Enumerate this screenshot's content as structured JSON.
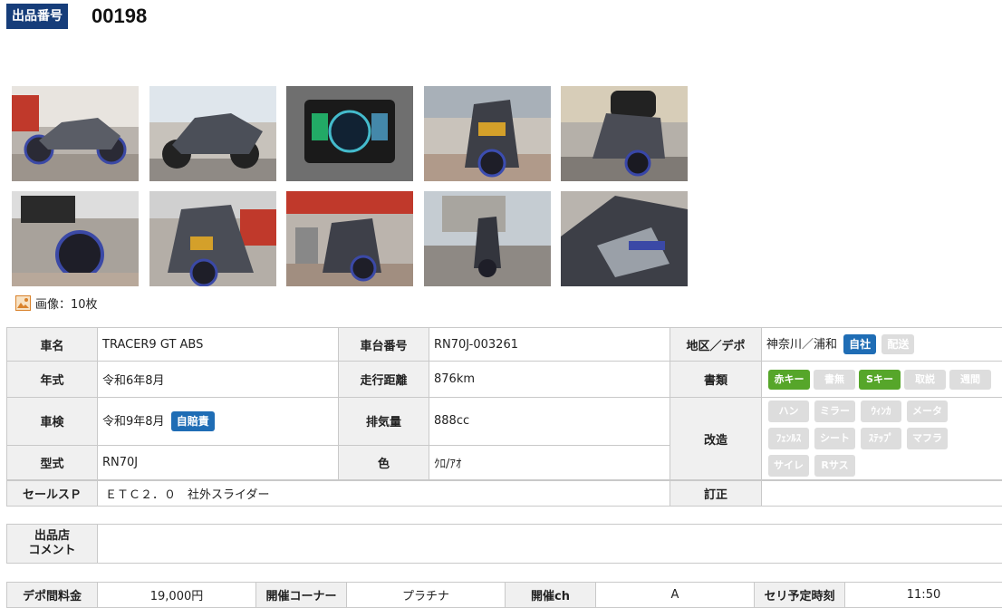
{
  "header": {
    "label": "出品番号",
    "number": "00198"
  },
  "gallery": {
    "count_text": "画像：10枚",
    "thumbnails": [
      "side-view-photo",
      "left-side-photo",
      "dashboard-photo",
      "front-view-photo",
      "rear-view-photo",
      "rear-wheel-photo",
      "front-angle-photo",
      "street-photo",
      "road-photo",
      "closeup-photo"
    ]
  },
  "info": {
    "rows": [
      {
        "l1": "車名",
        "v1": "TRACER9 GT ABS",
        "l2": "車台番号",
        "v2": "RN70J-003261",
        "l3": "地区／デポ",
        "v3": "神奈川／浦和",
        "tags": [
          {
            "text": "自社",
            "style": "blue"
          },
          {
            "text": "配送",
            "style": "grey"
          }
        ]
      },
      {
        "l1": "年式",
        "v1": "令和6年8月",
        "l2": "走行距離",
        "v2": "876km",
        "l3": "書類",
        "tags": [
          {
            "text": "赤キー",
            "style": "green"
          },
          {
            "text": "書無",
            "style": "grey"
          },
          {
            "text": "Sキー",
            "style": "green"
          },
          {
            "text": "取説",
            "style": "grey"
          },
          {
            "text": "週間",
            "style": "grey"
          }
        ]
      },
      {
        "l1": "車検",
        "v1": "令和9年8月",
        "badge": "自賠責",
        "l2": "排気量",
        "v2": "888cc",
        "l3": "改造"
      },
      {
        "l1": "型式",
        "v1": "RN70J",
        "l2": "色",
        "v2": "ｸﾛ/ｱｵ"
      }
    ],
    "mods": [
      "ハン",
      "ミラー",
      "ｳｨﾝｶ",
      "メータ",
      "ﾌｪﾝﾙｽ",
      "シート",
      "ｽﾃｯﾌﾟ",
      "マフラ",
      "サイレ",
      "Rサス"
    ]
  },
  "sales": {
    "label": "セールスＰ",
    "value": "ＥＴＣ２．０　社外スライダー",
    "label2": "訂正",
    "value2": ""
  },
  "comment": {
    "label_line1": "出品店",
    "label_line2": "コメント",
    "value": ""
  },
  "fees": {
    "l1": "デポ間料金",
    "v1": "19,000円",
    "l2": "開催コーナー",
    "v2": "プラチナ",
    "l3": "開催ch",
    "v3": "A",
    "l4": "セリ予定時刻",
    "v4": "11:50"
  },
  "colors": {
    "header_bg": "#163d7a",
    "tag_blue": "#1f6db5",
    "tag_green": "#56a62a",
    "tag_grey": "#dddddd"
  }
}
